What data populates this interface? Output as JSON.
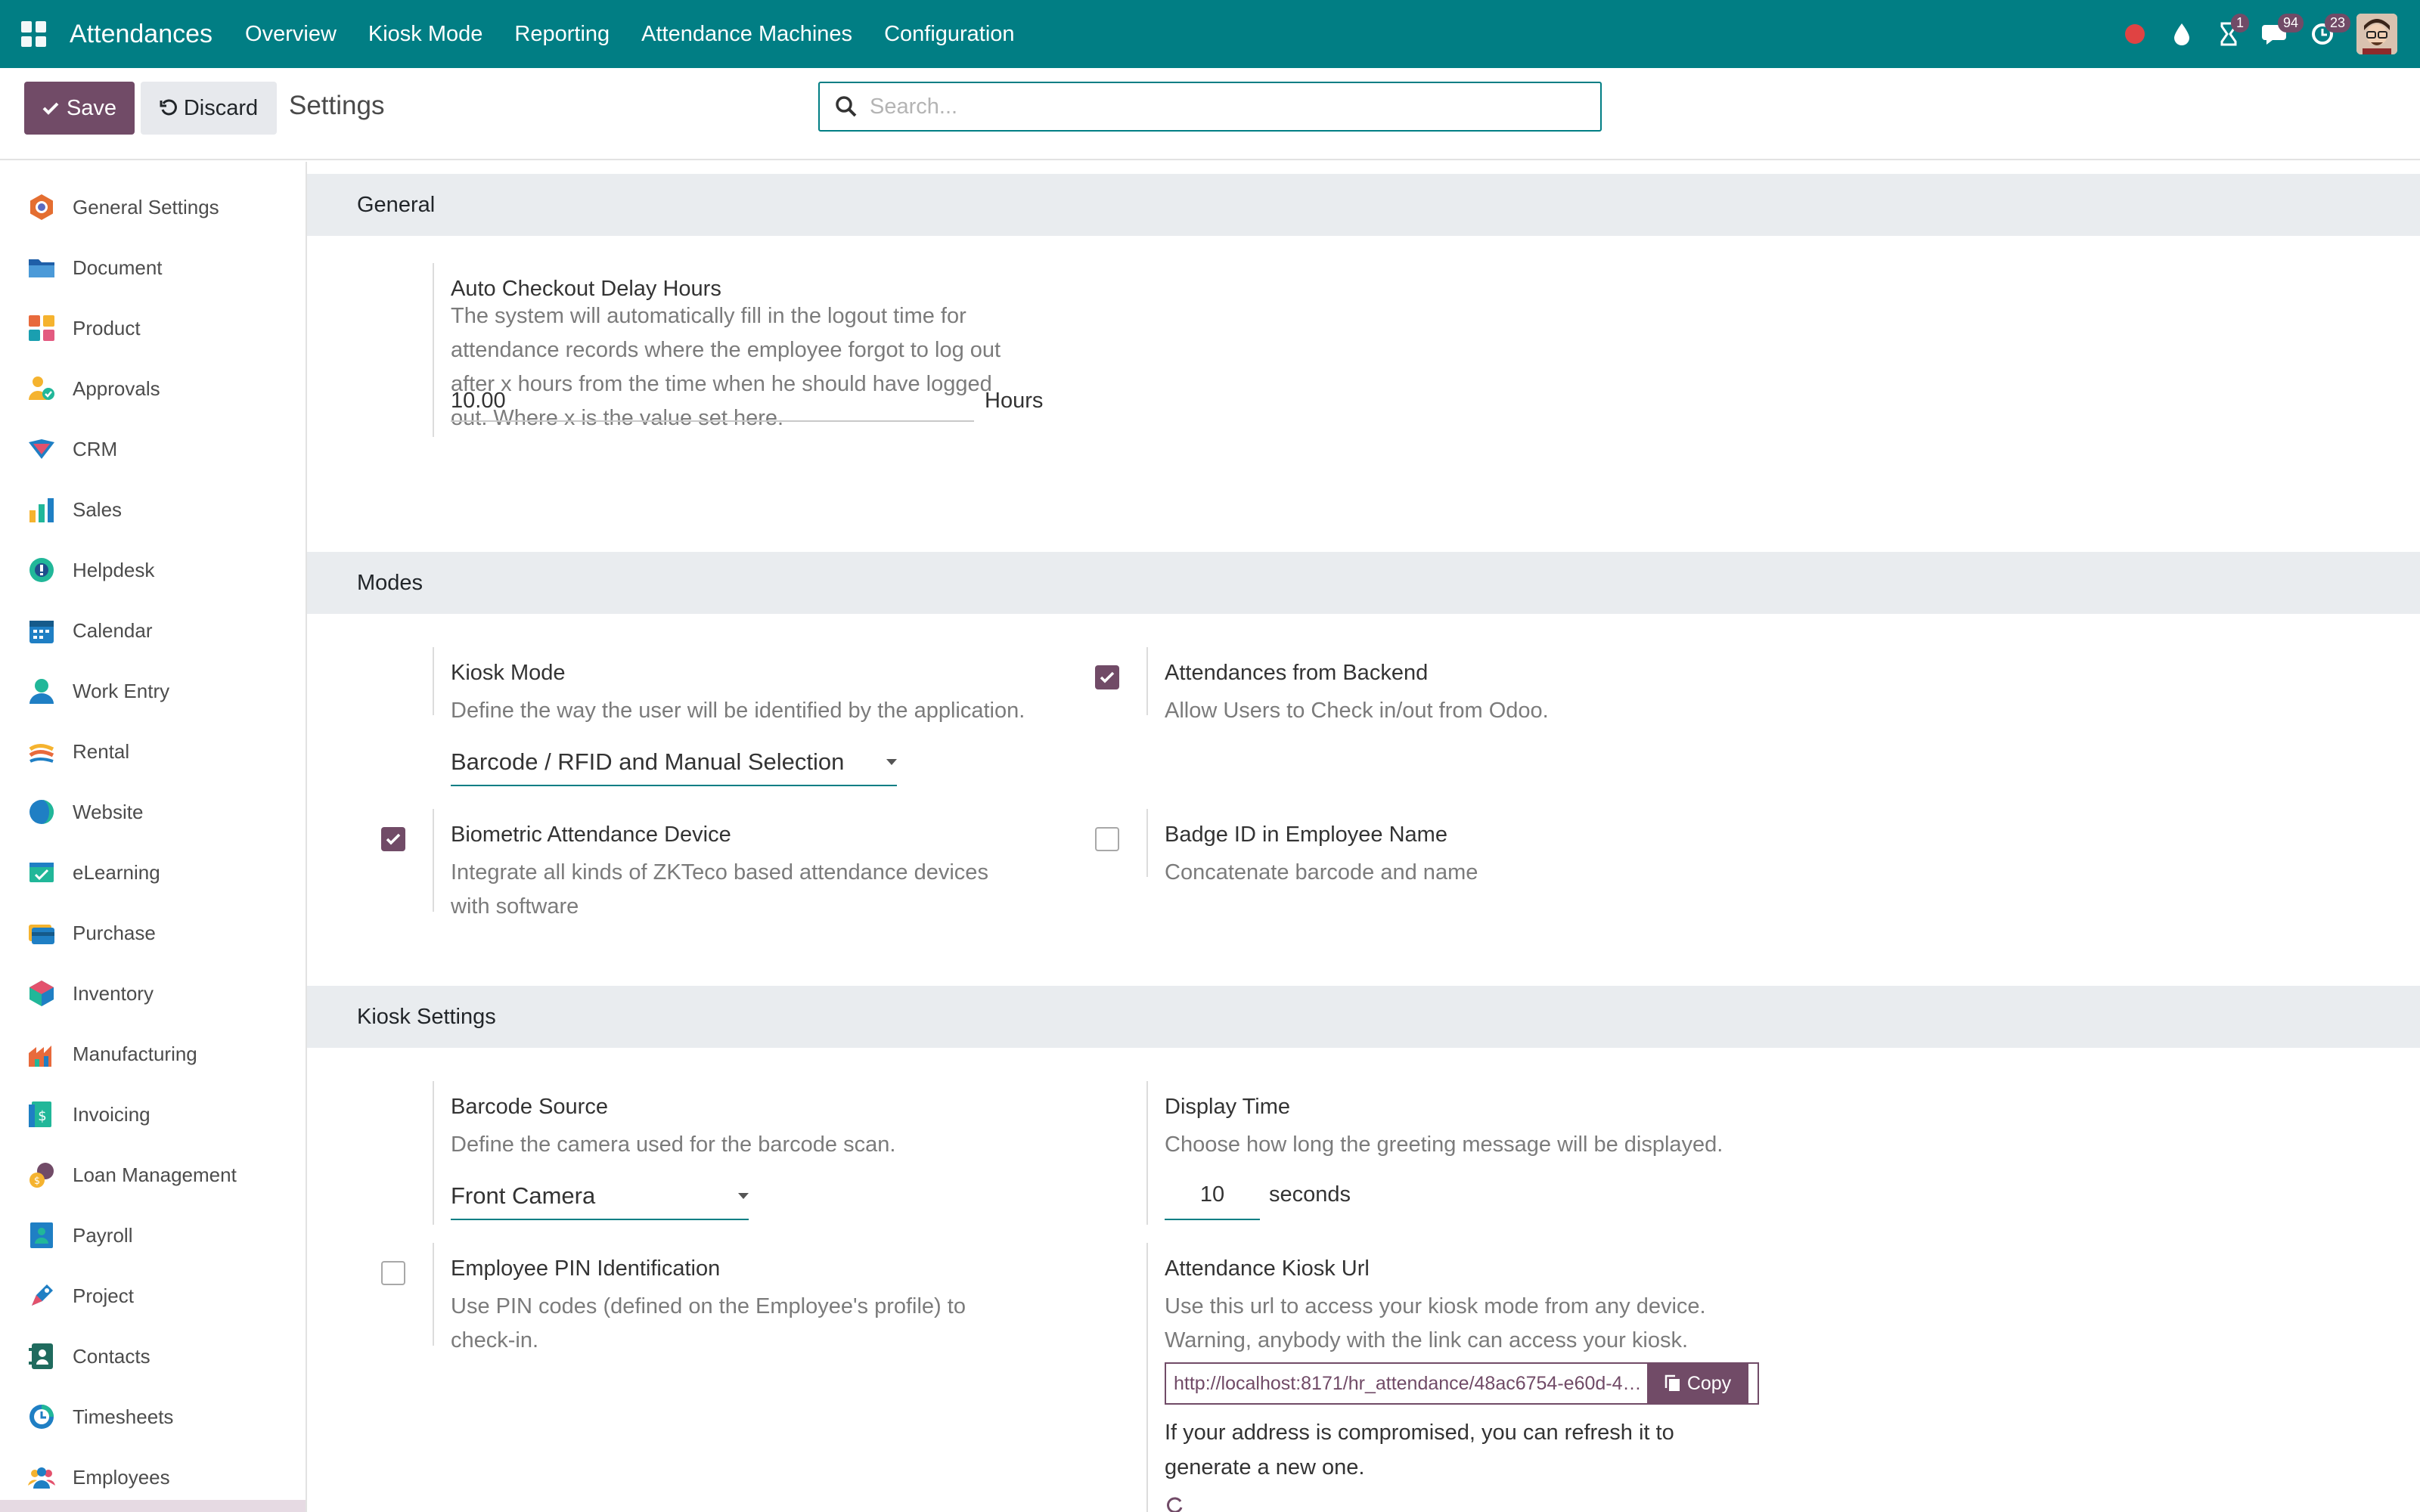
{
  "topbar": {
    "app_name": "Attendances",
    "menu": [
      "Overview",
      "Kiosk Mode",
      "Reporting",
      "Attendance Machines",
      "Configuration"
    ],
    "badges": {
      "activity": "1",
      "messages": "94",
      "updates": "23"
    },
    "colors": {
      "brand": "#017e84",
      "accent": "#714b67"
    }
  },
  "control": {
    "save_label": "Save",
    "discard_label": "Discard",
    "breadcrumb": "Settings",
    "search_placeholder": "Search..."
  },
  "sidebar": {
    "items": [
      {
        "label": "General Settings",
        "icon": "general-settings-icon"
      },
      {
        "label": "Document",
        "icon": "folder-icon"
      },
      {
        "label": "Product",
        "icon": "product-icon"
      },
      {
        "label": "Approvals",
        "icon": "approvals-icon"
      },
      {
        "label": "CRM",
        "icon": "crm-icon"
      },
      {
        "label": "Sales",
        "icon": "sales-icon"
      },
      {
        "label": "Helpdesk",
        "icon": "helpdesk-icon"
      },
      {
        "label": "Calendar",
        "icon": "calendar-icon"
      },
      {
        "label": "Work Entry",
        "icon": "work-entry-icon"
      },
      {
        "label": "Rental",
        "icon": "rental-icon"
      },
      {
        "label": "Website",
        "icon": "website-icon"
      },
      {
        "label": "eLearning",
        "icon": "elearning-icon"
      },
      {
        "label": "Purchase",
        "icon": "purchase-icon"
      },
      {
        "label": "Inventory",
        "icon": "inventory-icon"
      },
      {
        "label": "Manufacturing",
        "icon": "manufacturing-icon"
      },
      {
        "label": "Invoicing",
        "icon": "invoicing-icon"
      },
      {
        "label": "Loan Management",
        "icon": "loan-icon"
      },
      {
        "label": "Payroll",
        "icon": "payroll-icon"
      },
      {
        "label": "Project",
        "icon": "project-icon"
      },
      {
        "label": "Contacts",
        "icon": "contacts-icon"
      },
      {
        "label": "Timesheets",
        "icon": "timesheets-icon"
      },
      {
        "label": "Employees",
        "icon": "employees-icon"
      }
    ]
  },
  "general": {
    "title": "General",
    "auto_checkout": {
      "title": "Auto Checkout Delay Hours",
      "desc": [
        "The system will automatically fill in the logout time for",
        "attendance records where the employee forgot to log out",
        "after x hours from the time when he should have logged",
        "out. Where x is the value set here."
      ],
      "value": "10.00",
      "unit": "Hours"
    }
  },
  "modes": {
    "title": "Modes",
    "kiosk_mode": {
      "title": "Kiosk Mode",
      "desc": "Define the way the user will be identified by the application.",
      "value": "Barcode / RFID and Manual Selection"
    },
    "backend": {
      "title": "Attendances from Backend",
      "desc": "Allow Users to Check in/out from Odoo.",
      "checked": true
    },
    "biometric": {
      "title": "Biometric Attendance Device",
      "desc": [
        "Integrate all kinds of ZKTeco based attendance devices",
        "with software"
      ],
      "checked": true
    },
    "badge_id": {
      "title": "Badge ID in Employee Name",
      "desc": "Concatenate barcode and name",
      "checked": false
    }
  },
  "kiosk": {
    "title": "Kiosk Settings",
    "barcode_source": {
      "title": "Barcode Source",
      "desc": "Define the camera used for the barcode scan.",
      "value": "Front Camera"
    },
    "display_time": {
      "title": "Display Time",
      "desc": "Choose how long the greeting message will be displayed.",
      "value": "10",
      "unit": "seconds"
    },
    "pin": {
      "title": "Employee PIN Identification",
      "desc": [
        "Use PIN codes (defined on the Employee's profile) to",
        "check-in."
      ],
      "checked": false
    },
    "url": {
      "title": "Attendance Kiosk Url",
      "desc": [
        "Use this url to access your kiosk mode from any device.",
        "Warning, anybody with the link can access your kiosk."
      ],
      "value": "http://localhost:8171/hr_attendance/48ac6754-e60d-4c...",
      "copy_label": "Copy",
      "note": [
        "If your address is compromised, you can refresh it to",
        "generate a new one."
      ]
    }
  }
}
